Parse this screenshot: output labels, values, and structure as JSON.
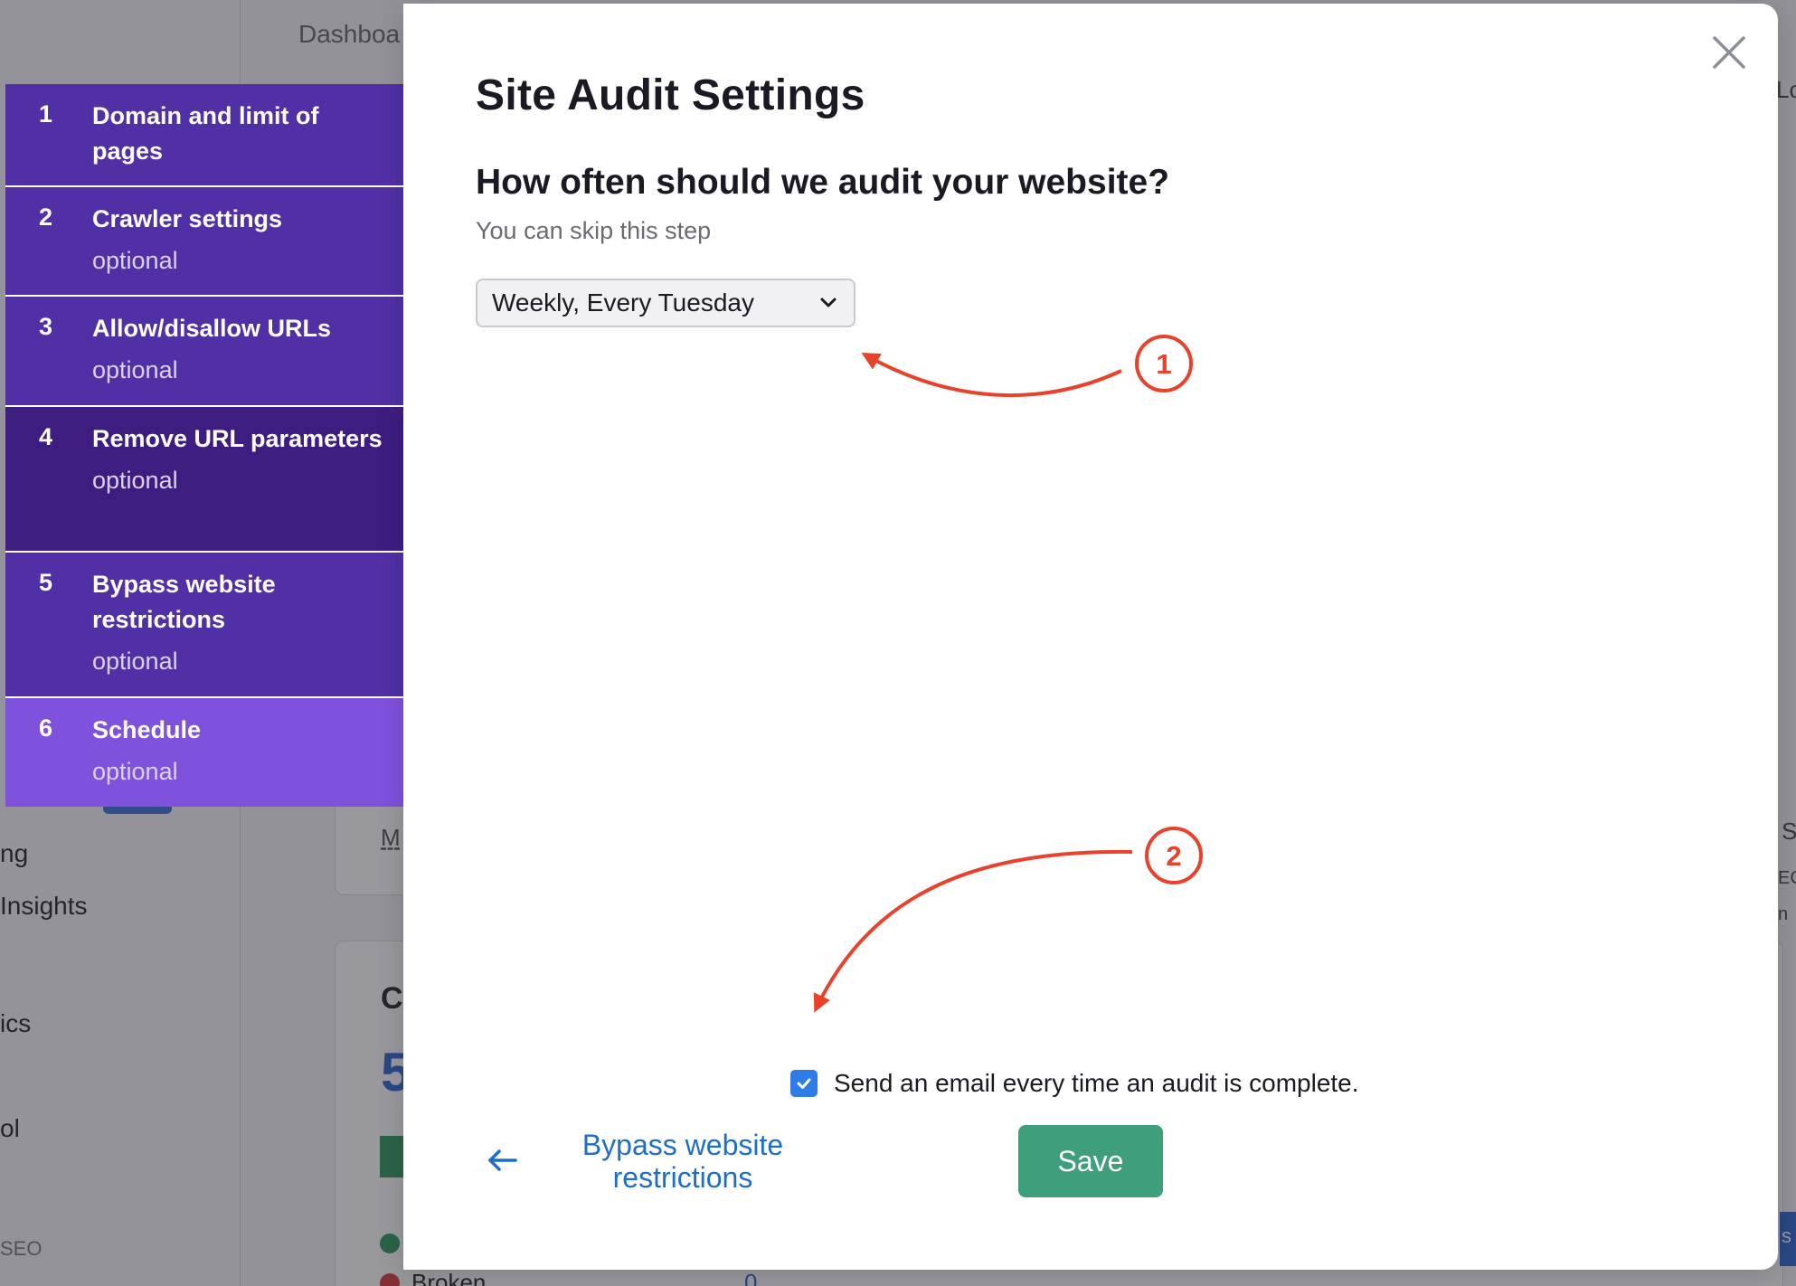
{
  "background": {
    "breadcrumb": "Dashboa",
    "sidebar_fragments": [
      "ng",
      "Insights",
      "ics",
      "ol",
      "SEO"
    ],
    "right_fragments": [
      "Lc",
      "S",
      "EC",
      "n",
      "s"
    ],
    "card_fragments": [
      "M",
      "C",
      "5",
      "Broken",
      "0"
    ]
  },
  "steps": [
    {
      "number": "1",
      "title": "Domain and limit of pages",
      "subtitle": ""
    },
    {
      "number": "2",
      "title": "Crawler settings",
      "subtitle": "optional"
    },
    {
      "number": "3",
      "title": "Allow/disallow URLs",
      "subtitle": "optional"
    },
    {
      "number": "4",
      "title": "Remove URL parameters",
      "subtitle": "optional"
    },
    {
      "number": "5",
      "title": "Bypass website restrictions",
      "subtitle": "optional"
    },
    {
      "number": "6",
      "title": "Schedule",
      "subtitle": "optional"
    }
  ],
  "modal": {
    "title": "Site Audit Settings",
    "question": "How often should we audit your website?",
    "hint": "You can skip this step",
    "schedule_select": {
      "value": "Weekly, Every Tuesday"
    },
    "email_checkbox": {
      "checked": true,
      "label": "Send an email every time an audit is complete."
    },
    "back_link": "Bypass website restrictions",
    "save_label": "Save"
  },
  "annotations": [
    {
      "label": "1",
      "color": "#e8412c"
    },
    {
      "label": "2",
      "color": "#e8412c"
    }
  ],
  "colors": {
    "step_bg": "#5130a6",
    "step_hover_bg": "#3d1e80",
    "step_active_bg": "#7e52dc",
    "link": "#1f6ec6",
    "save_bg": "#3f9f7a",
    "checkbox": "#2f7be8",
    "annotation": "#e8412c"
  }
}
